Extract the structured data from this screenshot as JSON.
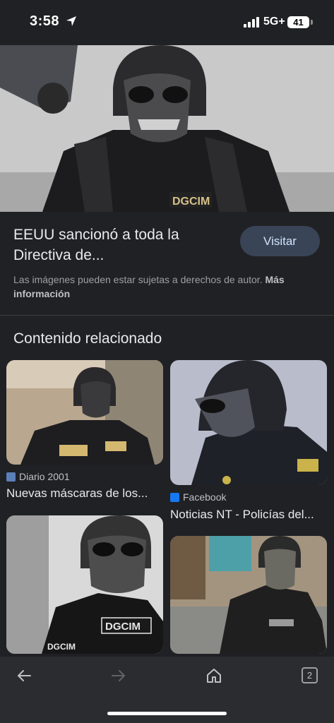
{
  "status_bar": {
    "time": "3:58",
    "network": "5G+",
    "battery": "41"
  },
  "result": {
    "title": "EEUU sancionó a toda la Directiva de...",
    "visit_label": "Visitar",
    "copyright_text": "Las imágenes pueden estar sujetas a derechos de autor.",
    "more_info_label": "Más información"
  },
  "related": {
    "heading": "Contenido relacionado",
    "items": [
      {
        "source": "Diario 2001",
        "caption": "Nuevas máscaras de los..."
      },
      {
        "source": "Facebook",
        "caption": "Noticias NT - Policías del..."
      },
      {
        "source": "",
        "caption": ""
      },
      {
        "source": "",
        "caption": ""
      }
    ]
  },
  "toolbar": {
    "tab_count": "2"
  },
  "colors": {
    "background": "#202124",
    "visit_button": "#394457",
    "toolbar": "#2b2c30"
  },
  "icons": [
    "location-arrow-icon",
    "signal-icon",
    "battery-icon",
    "back-arrow-icon",
    "forward-arrow-icon",
    "home-icon",
    "tabs-icon",
    "diario-favicon",
    "facebook-favicon"
  ]
}
